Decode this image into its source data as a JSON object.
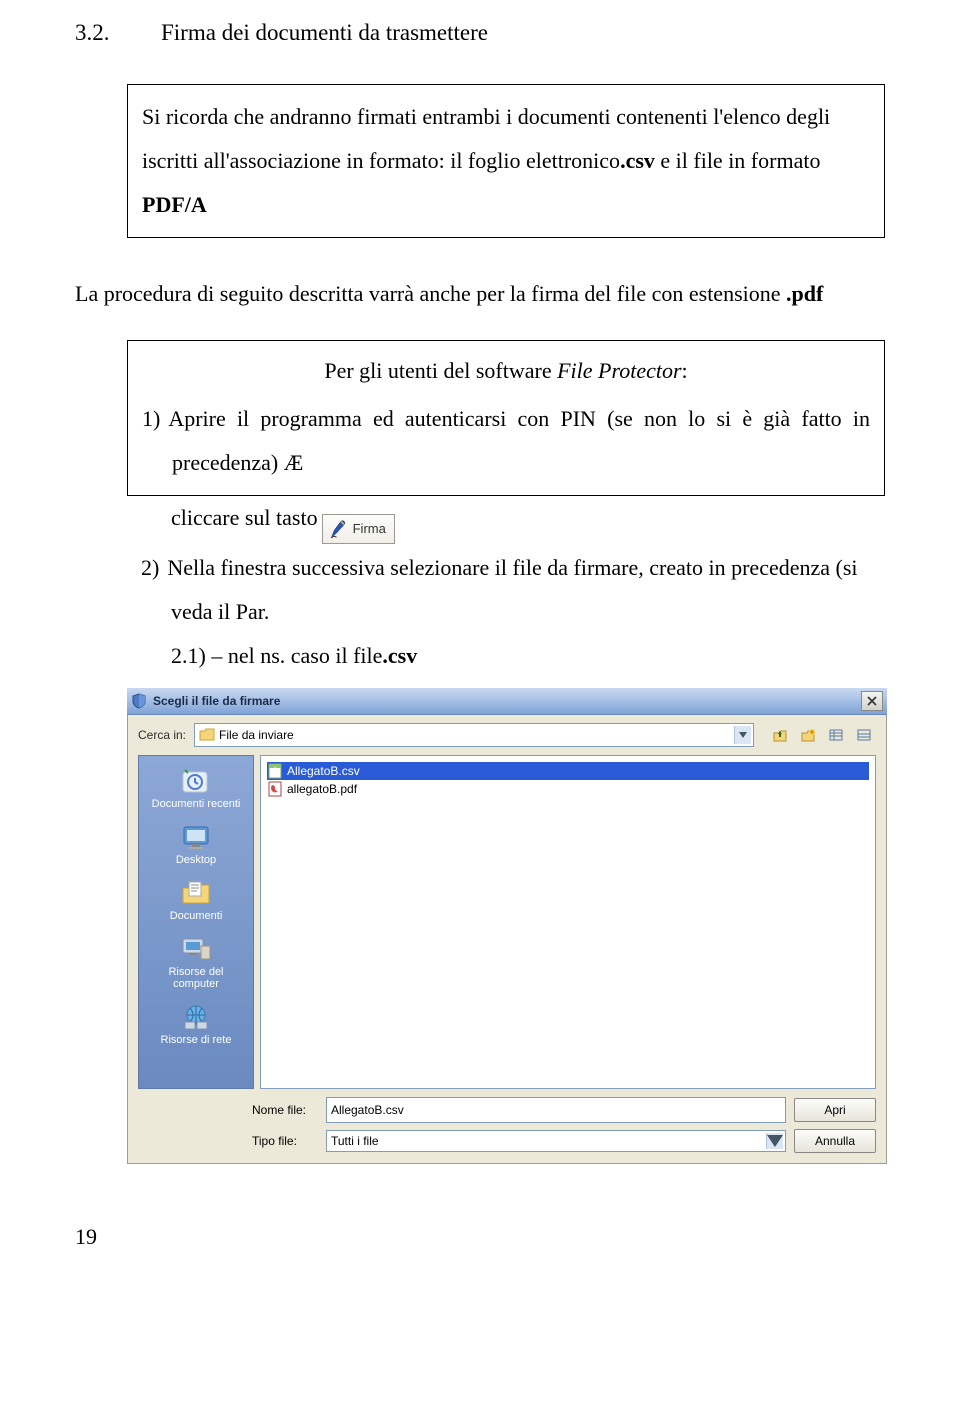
{
  "heading": {
    "number": "3.2.",
    "title": "Firma dei documenti da trasmettere"
  },
  "callout1": {
    "text_prefix": "Si ricorda che andranno firmati entrambi i documenti contenenti l'elenco degli iscritti all'associazione in formato: il foglio elettronico",
    "csv": ".csv",
    "text_mid": " e il file in formato ",
    "pdfa": "PDF/A"
  },
  "para1": {
    "text": "La procedura di seguito descritta varrà anche per la firma del file con estensione ",
    "ext": ".pdf"
  },
  "box2": {
    "head_prefix": "Per gli utenti del software ",
    "head_soft": "File Protector",
    "head_suffix": ":",
    "item1_num": "1)",
    "item1_text": "Aprire il programma ed autenticarsi con PIN (se non lo si è già fatto in precedenza) Æ"
  },
  "after": {
    "row1_prefix": "cliccare sul tasto ",
    "firma_label": "Firma",
    "item2_num": "2)",
    "item2_text_a": "Nella finestra successiva selezionare il file da firmare, creato in precedenza (si veda il Par.",
    "item2_text_b": "2.1) – nel ns. caso il file",
    "item2_csv": ".csv"
  },
  "dialog": {
    "title": "Scegli il file da firmare",
    "search_label": "Cerca in:",
    "folder": "File da inviare",
    "filename_label": "Nome file:",
    "filetype_label": "Tipo file:",
    "filename_value": "AllegatoB.csv",
    "filetype_value": "Tutti i file",
    "open_label": "Apri",
    "cancel_label": "Annulla",
    "files": [
      {
        "name": "AllegatoB.csv",
        "selected": true
      },
      {
        "name": "allegatoB.pdf",
        "selected": false
      }
    ],
    "places": [
      "Documenti recenti",
      "Desktop",
      "Documenti",
      "Risorse del computer",
      "Risorse di rete"
    ]
  },
  "pagenum": "19"
}
